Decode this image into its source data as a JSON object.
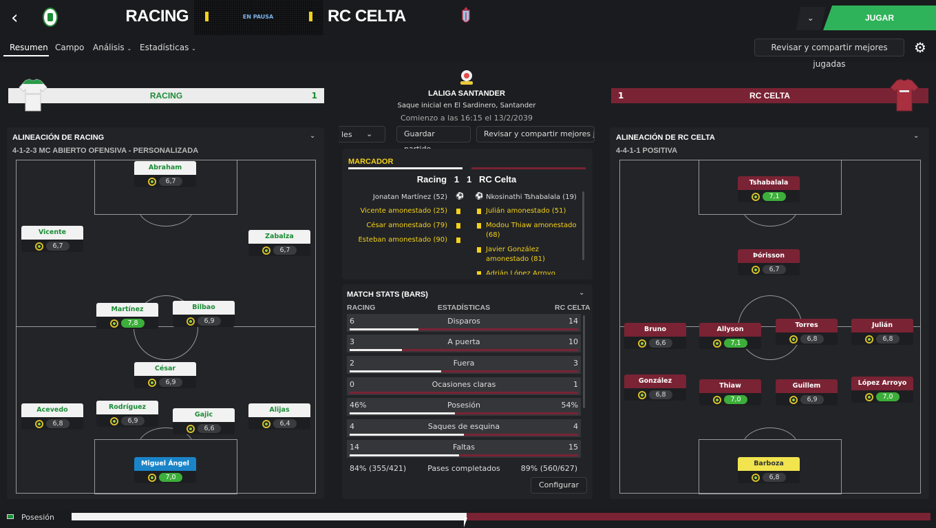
{
  "header": {
    "home_team": "RACING",
    "away_team": "RC CELTA",
    "status": "EN PAUSA",
    "play_label": "JUGAR"
  },
  "tabs": [
    {
      "label": "Resumen",
      "active": true
    },
    {
      "label": "Campo"
    },
    {
      "label": "Análisis",
      "dropdown": true
    },
    {
      "label": "Estadísticas",
      "dropdown": true
    }
  ],
  "review_label": "Revisar y compartir mejores jugadas",
  "home": {
    "name": "RACING",
    "score": "1",
    "lineup_title": "ALINEACIÓN DE RACING",
    "formation": "4-1-2-3 MC ABIERTO OFENSIVA - PERSONALIZADA",
    "players": [
      {
        "name": "Abraham",
        "rating": "6,7"
      },
      {
        "name": "Vicente",
        "rating": "6,7"
      },
      {
        "name": "Zabalza",
        "rating": "6,7"
      },
      {
        "name": "Martínez",
        "rating": "7,8",
        "hi": true
      },
      {
        "name": "Bilbao",
        "rating": "6,9"
      },
      {
        "name": "César",
        "rating": "6,9"
      },
      {
        "name": "Acevedo",
        "rating": "6,8"
      },
      {
        "name": "Rodríguez",
        "rating": "6,9"
      },
      {
        "name": "Gajic",
        "rating": "6,6"
      },
      {
        "name": "Alijas",
        "rating": "6,4"
      },
      {
        "name": "Miguel Ángel",
        "rating": "7,0",
        "hi": true
      }
    ]
  },
  "away": {
    "name": "RC CELTA",
    "score": "1",
    "lineup_title": "ALINEACIÓN DE RC CELTA",
    "formation": "4-4-1-1 POSITIVA",
    "players": [
      {
        "name": "Tshabalala",
        "rating": "7,1",
        "hi": true
      },
      {
        "name": "Þórisson",
        "rating": "6,7"
      },
      {
        "name": "Bruno",
        "rating": "6,6"
      },
      {
        "name": "Allyson",
        "rating": "7,1",
        "hi": true
      },
      {
        "name": "Torres",
        "rating": "6,8"
      },
      {
        "name": "Julián",
        "rating": "6,8"
      },
      {
        "name": "González",
        "rating": "6,8"
      },
      {
        "name": "Thiaw",
        "rating": "7,0",
        "hi": true
      },
      {
        "name": "Guillem",
        "rating": "6,9"
      },
      {
        "name": "López Arroyo",
        "rating": "7,0",
        "hi": true
      },
      {
        "name": "Barboza",
        "rating": "6,8"
      }
    ]
  },
  "match": {
    "league": "LALIGA SANTANDER",
    "venue": "Saque inicial en El Sardinero, Santander",
    "kickoff": "Comienzo a las 16:15 el 13/2/2039",
    "btn_partial": "les",
    "save_label": "Guardar partido",
    "review_partial": "Revisar y compartir mejores ju"
  },
  "scoreboard": {
    "title": "MARCADOR",
    "line": "Racing   1   1   RC Celta",
    "home_events": [
      {
        "text": "Jonatan Martínez (52)",
        "type": "goal"
      },
      {
        "text": "Vicente amonestado (25)",
        "type": "yellow"
      },
      {
        "text": "César amonestado (79)",
        "type": "yellow"
      },
      {
        "text": "Esteban amonestado (90)",
        "type": "yellow"
      }
    ],
    "away_events": [
      {
        "text": "Nkosinathi Tshabalala (19)",
        "type": "goal"
      },
      {
        "text": "Julián amonestado (51)",
        "type": "yellow"
      },
      {
        "text": "Modou Thiaw amonestado",
        "type": "yellow"
      },
      {
        "text": "(68)",
        "type": "yellow-cont"
      },
      {
        "text": "Javier González",
        "type": "yellow"
      },
      {
        "text": "amonestado (81)",
        "type": "yellow-cont"
      },
      {
        "text": "Adrián López Arroyo",
        "type": "yellow"
      }
    ]
  },
  "stats": {
    "title": "MATCH STATS (BARS)",
    "col_home": "RACING",
    "col_mid": "ESTADÍSTICAS",
    "col_away": "RC CELTA",
    "rows": [
      {
        "label": "Disparos",
        "home": "6",
        "away": "14",
        "home_share": 0.3
      },
      {
        "label": "A puerta",
        "home": "3",
        "away": "10",
        "home_share": 0.23
      },
      {
        "label": "Fuera",
        "home": "2",
        "away": "3",
        "home_share": 0.4
      },
      {
        "label": "Ocasiones claras",
        "home": "0",
        "away": "1",
        "home_share": 0.0
      },
      {
        "label": "Posesión",
        "home": "46%",
        "away": "54%",
        "home_share": 0.46
      },
      {
        "label": "Saques de esquina",
        "home": "4",
        "away": "4",
        "home_share": 0.5
      },
      {
        "label": "Faltas",
        "home": "14",
        "away": "15",
        "home_share": 0.48
      }
    ],
    "passes_label": "Pases completados",
    "passes_home": "84% (355/421)",
    "passes_away": "89% (560/627)",
    "configure_label": "Configurar"
  },
  "possession": {
    "label": "Posesión",
    "home_share": 0.46,
    "colors": {
      "home": "#f2f2f2",
      "away": "#7a2334"
    }
  },
  "colors": {
    "home": "#1a8c35",
    "away": "#7a2334",
    "accent": "#2fb35a",
    "yellow": "#f3d21a"
  }
}
